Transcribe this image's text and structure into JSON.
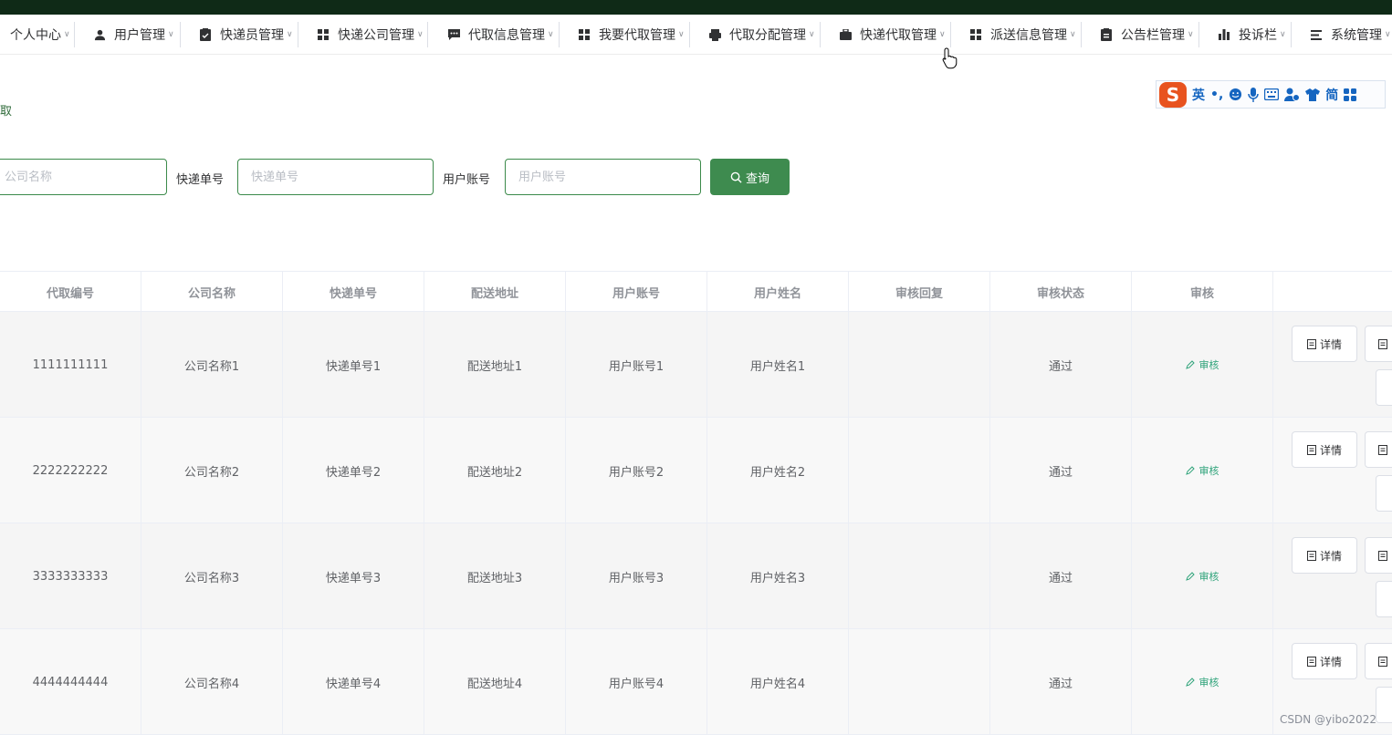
{
  "menu": [
    {
      "label": "个人中心",
      "icon": "none"
    },
    {
      "label": "用户管理",
      "icon": "user-icon"
    },
    {
      "label": "快递员管理",
      "icon": "clipboard-icon"
    },
    {
      "label": "快递公司管理",
      "icon": "grid-icon"
    },
    {
      "label": "代取信息管理",
      "icon": "chat-icon"
    },
    {
      "label": "我要代取管理",
      "icon": "grid-icon"
    },
    {
      "label": "代取分配管理",
      "icon": "printer-icon"
    },
    {
      "label": "快递代取管理",
      "icon": "briefcase-icon"
    },
    {
      "label": "派送信息管理",
      "icon": "grid-icon"
    },
    {
      "label": "公告栏管理",
      "icon": "clipboard-icon"
    },
    {
      "label": "投诉栏",
      "icon": "bar-chart-icon"
    },
    {
      "label": "系统管理",
      "icon": "list-icon"
    }
  ],
  "breadcrumb": "取",
  "ime": {
    "logo": "S",
    "lang": "英",
    "punct": "•,",
    "simplified": "简"
  },
  "search": {
    "company_placeholder": "公司名称",
    "tracking_label": "快递单号",
    "tracking_placeholder": "快递单号",
    "account_label": "用户账号",
    "account_placeholder": "用户账号",
    "query_label": "查询"
  },
  "table": {
    "headers": [
      "代取编号",
      "公司名称",
      "快递单号",
      "配送地址",
      "用户账号",
      "用户姓名",
      "审核回复",
      "审核状态",
      "审核",
      ""
    ],
    "rows": [
      {
        "id": "1111111111",
        "company": "公司名称1",
        "tracking": "快递单号1",
        "address": "配送地址1",
        "account": "用户账号1",
        "name": "用户姓名1",
        "reply": "",
        "status": "通过",
        "audit": "审核"
      },
      {
        "id": "2222222222",
        "company": "公司名称2",
        "tracking": "快递单号2",
        "address": "配送地址2",
        "account": "用户账号2",
        "name": "用户姓名2",
        "reply": "",
        "status": "通过",
        "audit": "审核"
      },
      {
        "id": "3333333333",
        "company": "公司名称3",
        "tracking": "快递单号3",
        "address": "配送地址3",
        "account": "用户账号3",
        "name": "用户姓名3",
        "reply": "",
        "status": "通过",
        "audit": "审核"
      },
      {
        "id": "4444444444",
        "company": "公司名称4",
        "tracking": "快递单号4",
        "address": "配送地址4",
        "account": "用户账号4",
        "name": "用户姓名4",
        "reply": "",
        "status": "通过",
        "audit": "审核"
      }
    ],
    "detail_label": "详情"
  },
  "watermark": "CSDN @yibo2022",
  "colors": {
    "topbar": "#0f2a17",
    "primary": "#3e8b4f",
    "audit": "#2fa37a"
  }
}
